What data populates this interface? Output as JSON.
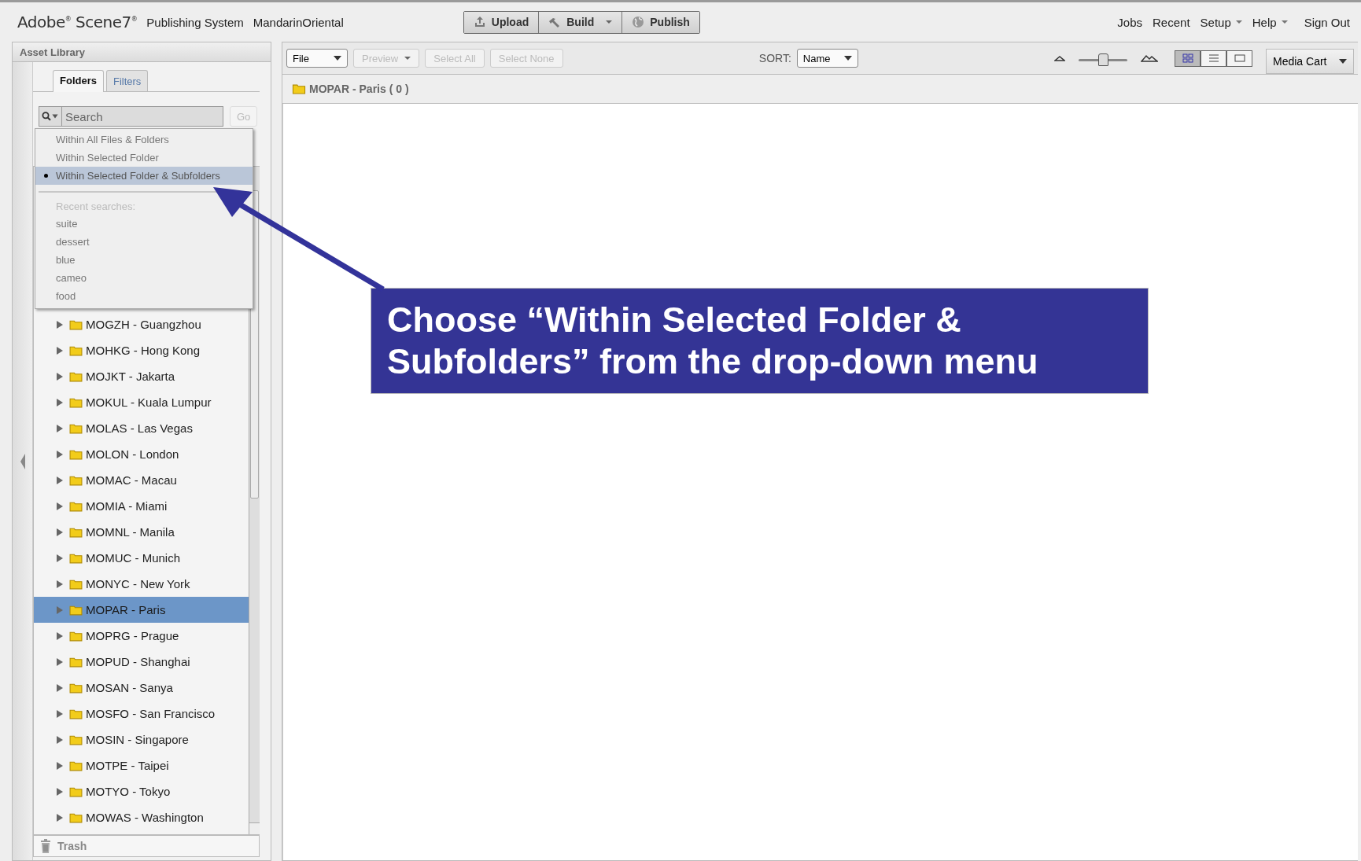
{
  "header": {
    "logo": "Adobe$^{®}$ Scene7$^{®}$",
    "product": "Publishing System",
    "company": "MandarinOriental",
    "actions": [
      {
        "label": "Upload",
        "kind": "upload",
        "has_menu": false
      },
      {
        "label": "Build",
        "kind": "build",
        "has_menu": true
      },
      {
        "label": "Publish",
        "kind": "publish",
        "has_menu": false
      }
    ],
    "nav": [
      {
        "label": "Jobs",
        "has_menu": false
      },
      {
        "label": "Recent",
        "has_menu": false
      },
      {
        "label": "Setup",
        "has_menu": true
      },
      {
        "label": "Help",
        "has_menu": true
      },
      {
        "label": "Sign Out",
        "has_menu": false
      }
    ]
  },
  "asset_library": {
    "title": "Asset Library",
    "tabs": [
      {
        "label": "Folders",
        "selected": true
      },
      {
        "label": "Filters",
        "selected": false
      }
    ],
    "search": {
      "placeholder": "Search",
      "go": "Go"
    },
    "scope_menu": {
      "options": [
        {
          "label": "Within All Files & Folders",
          "selected": false
        },
        {
          "label": "Within Selected Folder",
          "selected": false
        },
        {
          "label": "Within Selected Folder & Subfolders",
          "selected": true
        }
      ],
      "recent_label": "Recent searches:",
      "recent": [
        "suite",
        "dessert",
        "blue",
        "cameo",
        "food"
      ]
    },
    "folders": [
      {
        "name": "MOGZH - Guangzhou",
        "selected": false
      },
      {
        "name": "MOHKG - Hong Kong",
        "selected": false
      },
      {
        "name": "MOJKT - Jakarta",
        "selected": false
      },
      {
        "name": "MOKUL - Kuala Lumpur",
        "selected": false
      },
      {
        "name": "MOLAS - Las Vegas",
        "selected": false
      },
      {
        "name": "MOLON - London",
        "selected": false
      },
      {
        "name": "MOMAC - Macau",
        "selected": false
      },
      {
        "name": "MOMIA - Miami",
        "selected": false
      },
      {
        "name": "MOMNL - Manila",
        "selected": false
      },
      {
        "name": "MOMUC - Munich",
        "selected": false
      },
      {
        "name": "MONYC - New York",
        "selected": false
      },
      {
        "name": "MOPAR - Paris",
        "selected": true
      },
      {
        "name": "MOPRG - Prague",
        "selected": false
      },
      {
        "name": "MOPUD - Shanghai",
        "selected": false
      },
      {
        "name": "MOSAN - Sanya",
        "selected": false
      },
      {
        "name": "MOSFO - San Francisco",
        "selected": false
      },
      {
        "name": "MOSIN - Singapore",
        "selected": false
      },
      {
        "name": "MOTPE - Taipei",
        "selected": false
      },
      {
        "name": "MOTYO - Tokyo",
        "selected": false
      },
      {
        "name": "MOWAS - Washington",
        "selected": false
      }
    ],
    "trash": "Trash"
  },
  "toolbar": {
    "file": "File",
    "buttons": [
      {
        "label": "Preview",
        "disabled": true,
        "has_menu": true
      },
      {
        "label": "Select All",
        "disabled": true,
        "has_menu": false
      },
      {
        "label": "Select None",
        "disabled": true,
        "has_menu": false
      }
    ],
    "sort_label": "SORT:",
    "sort_value": "Name",
    "size_slider": {
      "level": 0.5
    },
    "views": [
      {
        "kind": "grid",
        "selected": true
      },
      {
        "kind": "list",
        "selected": false
      },
      {
        "kind": "single",
        "selected": false
      }
    ],
    "media_cart": "Media Cart"
  },
  "breadcrumb": "MOPAR - Paris ( 0 )",
  "callout": "Choose “Within Selected Folder & Subfolders” from the drop-down menu"
}
